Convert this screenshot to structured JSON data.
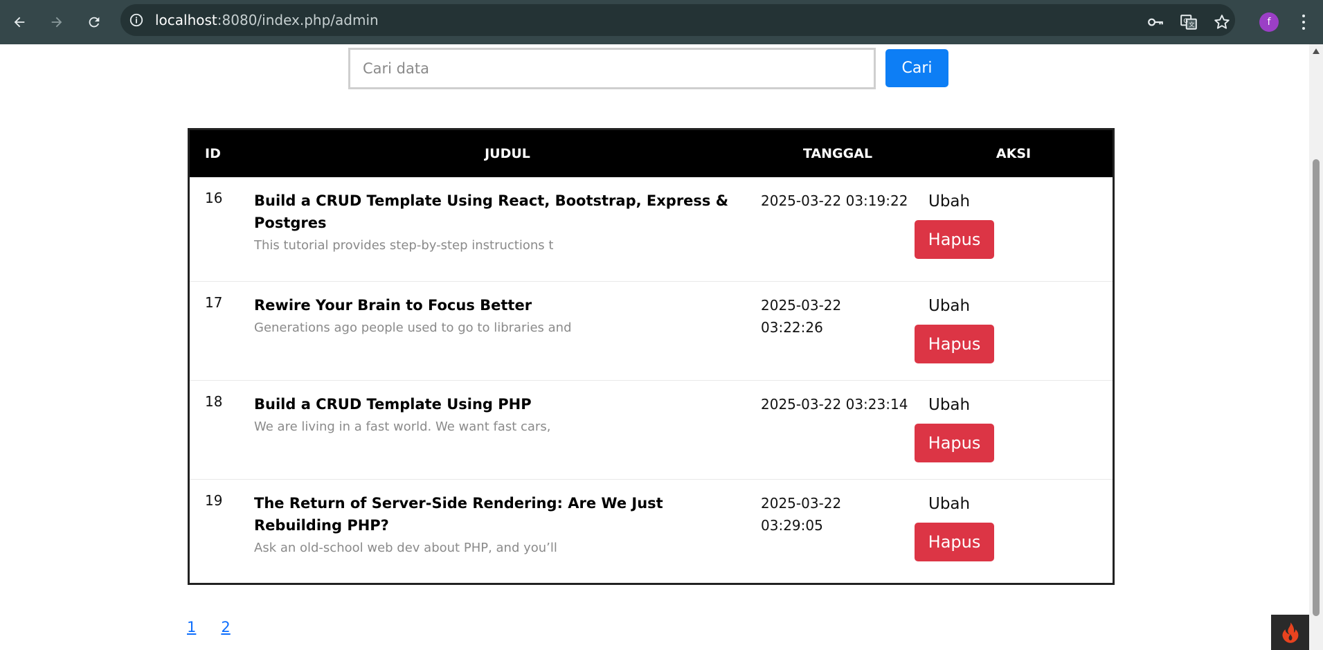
{
  "browser": {
    "url_host": "localhost",
    "url_rest": ":8080/index.php/admin",
    "profile_initial": "f"
  },
  "search": {
    "placeholder": "Cari data",
    "button_label": "Cari"
  },
  "table": {
    "headers": {
      "id": "ID",
      "judul": "JUDUL",
      "tanggal": "TANGGAL",
      "aksi": "AKSI"
    },
    "rows": [
      {
        "id": "16",
        "title": "Build a CRUD Template Using React, Bootstrap, Express & Postgres",
        "excerpt": "This tutorial provides step-by-step instructions t",
        "tanggal": "2025-03-22 03:19:22",
        "edit_label": "Ubah",
        "delete_label": "Hapus"
      },
      {
        "id": "17",
        "title": "Rewire Your Brain to Focus Better",
        "excerpt": "Generations ago people used to go to libraries and",
        "tanggal": "2025-03-22 03:22:26",
        "edit_label": "Ubah",
        "delete_label": "Hapus"
      },
      {
        "id": "18",
        "title": "Build a CRUD Template Using PHP",
        "excerpt": "We are living in a fast world. We want fast cars,",
        "tanggal": "2025-03-22 03:23:14",
        "edit_label": "Ubah",
        "delete_label": "Hapus"
      },
      {
        "id": "19",
        "title": "The Return of Server-Side Rendering: Are We Just Rebuilding PHP?",
        "excerpt": "Ask an old-school web dev about PHP, and you’ll",
        "tanggal": "2025-03-22 03:29:05",
        "edit_label": "Ubah",
        "delete_label": "Hapus"
      }
    ]
  },
  "pagination": {
    "pages": [
      "1",
      "2"
    ]
  },
  "colors": {
    "chrome_bg": "#35474a",
    "primary": "#0d7ef5",
    "danger": "#dc3545",
    "header_bg": "#000000",
    "link": "#0d6efd"
  },
  "icons": {
    "back": "arrow-left-icon",
    "forward": "arrow-right-icon",
    "reload": "reload-icon",
    "site_info": "info-icon",
    "password": "key-icon",
    "translate": "translate-icon",
    "bookmark": "star-icon",
    "menu": "more-vertical-icon",
    "debug_toolbar": "flame-icon"
  }
}
